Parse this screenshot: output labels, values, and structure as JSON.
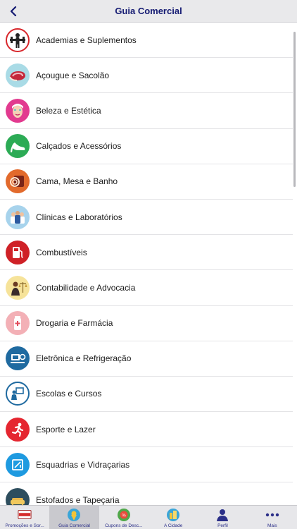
{
  "header": {
    "title": "Guia Comercial",
    "back_icon": "chevron-left-icon"
  },
  "categories": [
    {
      "label": "Academias e Suplementos",
      "icon": "fitness-icon"
    },
    {
      "label": "Açougue e Sacolão",
      "icon": "meat-icon"
    },
    {
      "label": "Beleza e Estética",
      "icon": "beauty-icon"
    },
    {
      "label": "Calçados e Acessórios",
      "icon": "high-heel-icon"
    },
    {
      "label": "Cama, Mesa e Banho",
      "icon": "towel-icon"
    },
    {
      "label": "Clínicas e Laboratórios",
      "icon": "doctors-icon"
    },
    {
      "label": "Combustíveis",
      "icon": "fuel-pump-icon"
    },
    {
      "label": "Contabilidade e Advocacia",
      "icon": "scales-icon"
    },
    {
      "label": "Drogaria e Farmácia",
      "icon": "pharmacy-icon"
    },
    {
      "label": "Eletrônica e Refrigeração",
      "icon": "electronics-icon"
    },
    {
      "label": "Escolas e Cursos",
      "icon": "school-icon"
    },
    {
      "label": "Esporte e Lazer",
      "icon": "running-icon"
    },
    {
      "label": "Esquadrias e Vidraçarias",
      "icon": "window-icon"
    },
    {
      "label": "Estofados e Tapeçaria",
      "icon": "sofa-icon"
    }
  ],
  "tabs": [
    {
      "label": "Promoções e Sor...",
      "icon": "promo-icon",
      "active": false
    },
    {
      "label": "Guia Comercial",
      "icon": "guide-icon",
      "active": true
    },
    {
      "label": "Cupons de Desc...",
      "icon": "coupon-icon",
      "active": false
    },
    {
      "label": "A Cidade",
      "icon": "city-icon",
      "active": false
    },
    {
      "label": "Perfil",
      "icon": "person-icon",
      "active": false
    },
    {
      "label": "Mais",
      "icon": "more-dots-icon",
      "active": false
    }
  ],
  "colors": {
    "title": "#141a72",
    "tab_label": "#2b2f88",
    "navbar_bg": "#e9e9eb"
  }
}
